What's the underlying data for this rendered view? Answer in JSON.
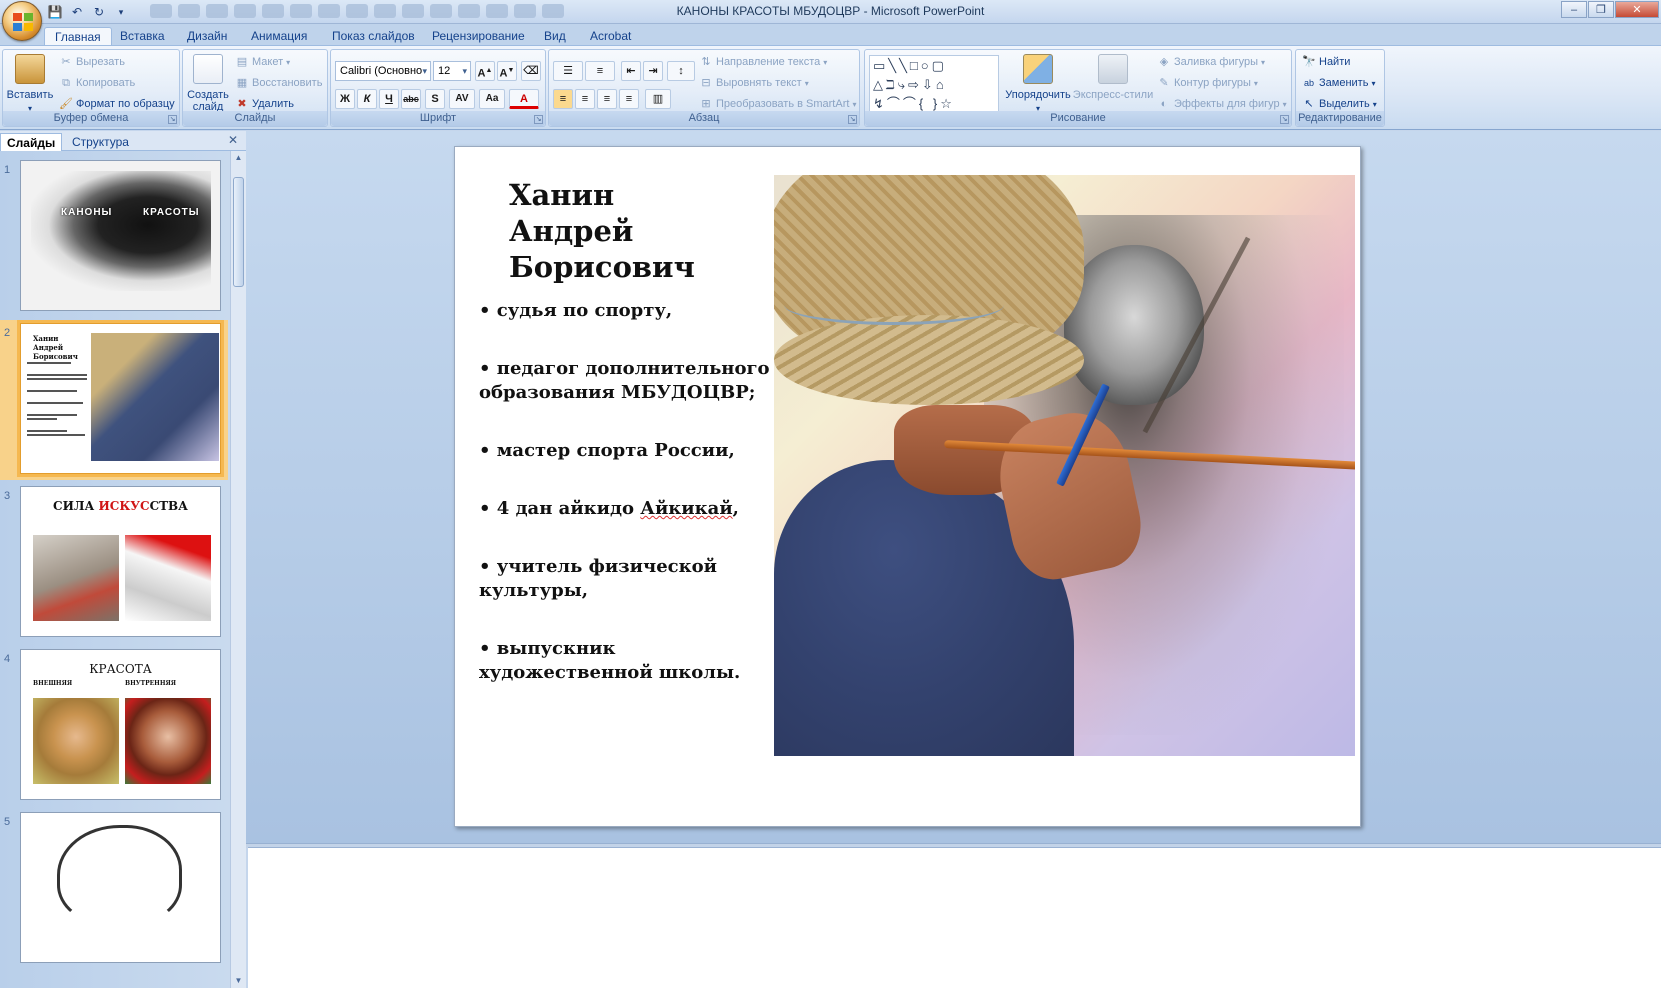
{
  "window": {
    "title": "КАНОНЫ КРАСОТЫ МБУДОЦВР - Microsoft PowerPoint"
  },
  "ribbon_tabs": [
    "Главная",
    "Вставка",
    "Дизайн",
    "Анимация",
    "Показ слайдов",
    "Рецензирование",
    "Вид",
    "Acrobat"
  ],
  "ribbon": {
    "clipboard": {
      "label": "Буфер обмена",
      "paste": "Вставить",
      "cut": "Вырезать",
      "copy": "Копировать",
      "format_painter": "Формат по образцу"
    },
    "slides": {
      "label": "Слайды",
      "new_slide": "Создать слайд",
      "layout": "Макет",
      "reset": "Восстановить",
      "delete": "Удалить"
    },
    "font": {
      "label": "Шрифт",
      "font_name": "Calibri (Основно",
      "font_size": "12",
      "bold": "Ж",
      "italic": "К",
      "underline": "Ч",
      "strike": "abc",
      "shadow": "S",
      "spacing": "AV",
      "case": "Aa",
      "color": "A"
    },
    "paragraph": {
      "label": "Абзац",
      "text_direction": "Направление текста",
      "align_text": "Выровнять текст",
      "smartart": "Преобразовать в SmartArt"
    },
    "drawing": {
      "label": "Рисование",
      "arrange": "Упорядочить",
      "quick_styles": "Экспресс-стили",
      "fill": "Заливка фигуры",
      "outline": "Контур фигуры",
      "effects": "Эффекты для фигур"
    },
    "editing": {
      "label": "Редактирование",
      "find": "Найти",
      "replace": "Заменить",
      "select": "Выделить"
    }
  },
  "pane": {
    "tab_slides": "Слайды",
    "tab_outline": "Структура",
    "thumbnails": [
      {
        "num": "1",
        "t1": "КАНОНЫ",
        "t2": "КРАСОТЫ"
      },
      {
        "num": "2",
        "title": "Ханин Андрей Борисович"
      },
      {
        "num": "3",
        "title_a": "СИЛА ",
        "title_b": "ИСКУС",
        "title_c": "СТВА"
      },
      {
        "num": "4",
        "title": "КРАСОТА",
        "left": "ВНЕШНЯЯ",
        "right": "ВНУТРЕННЯЯ"
      },
      {
        "num": "5"
      }
    ]
  },
  "slide": {
    "title_line1": "Ханин",
    "title_line2": "Андрей",
    "title_line3": "Борисович",
    "bullets": [
      "• судья по спорту,",
      "• педагог дополнительного",
      "образования МБУДОЦВР;",
      "• мастер спорта России,",
      "• 4 дан айкидо ",
      "Айкикай",
      ",",
      "• учитель физической",
      "культуры,",
      "• выпускник",
      "художественной школы."
    ]
  }
}
